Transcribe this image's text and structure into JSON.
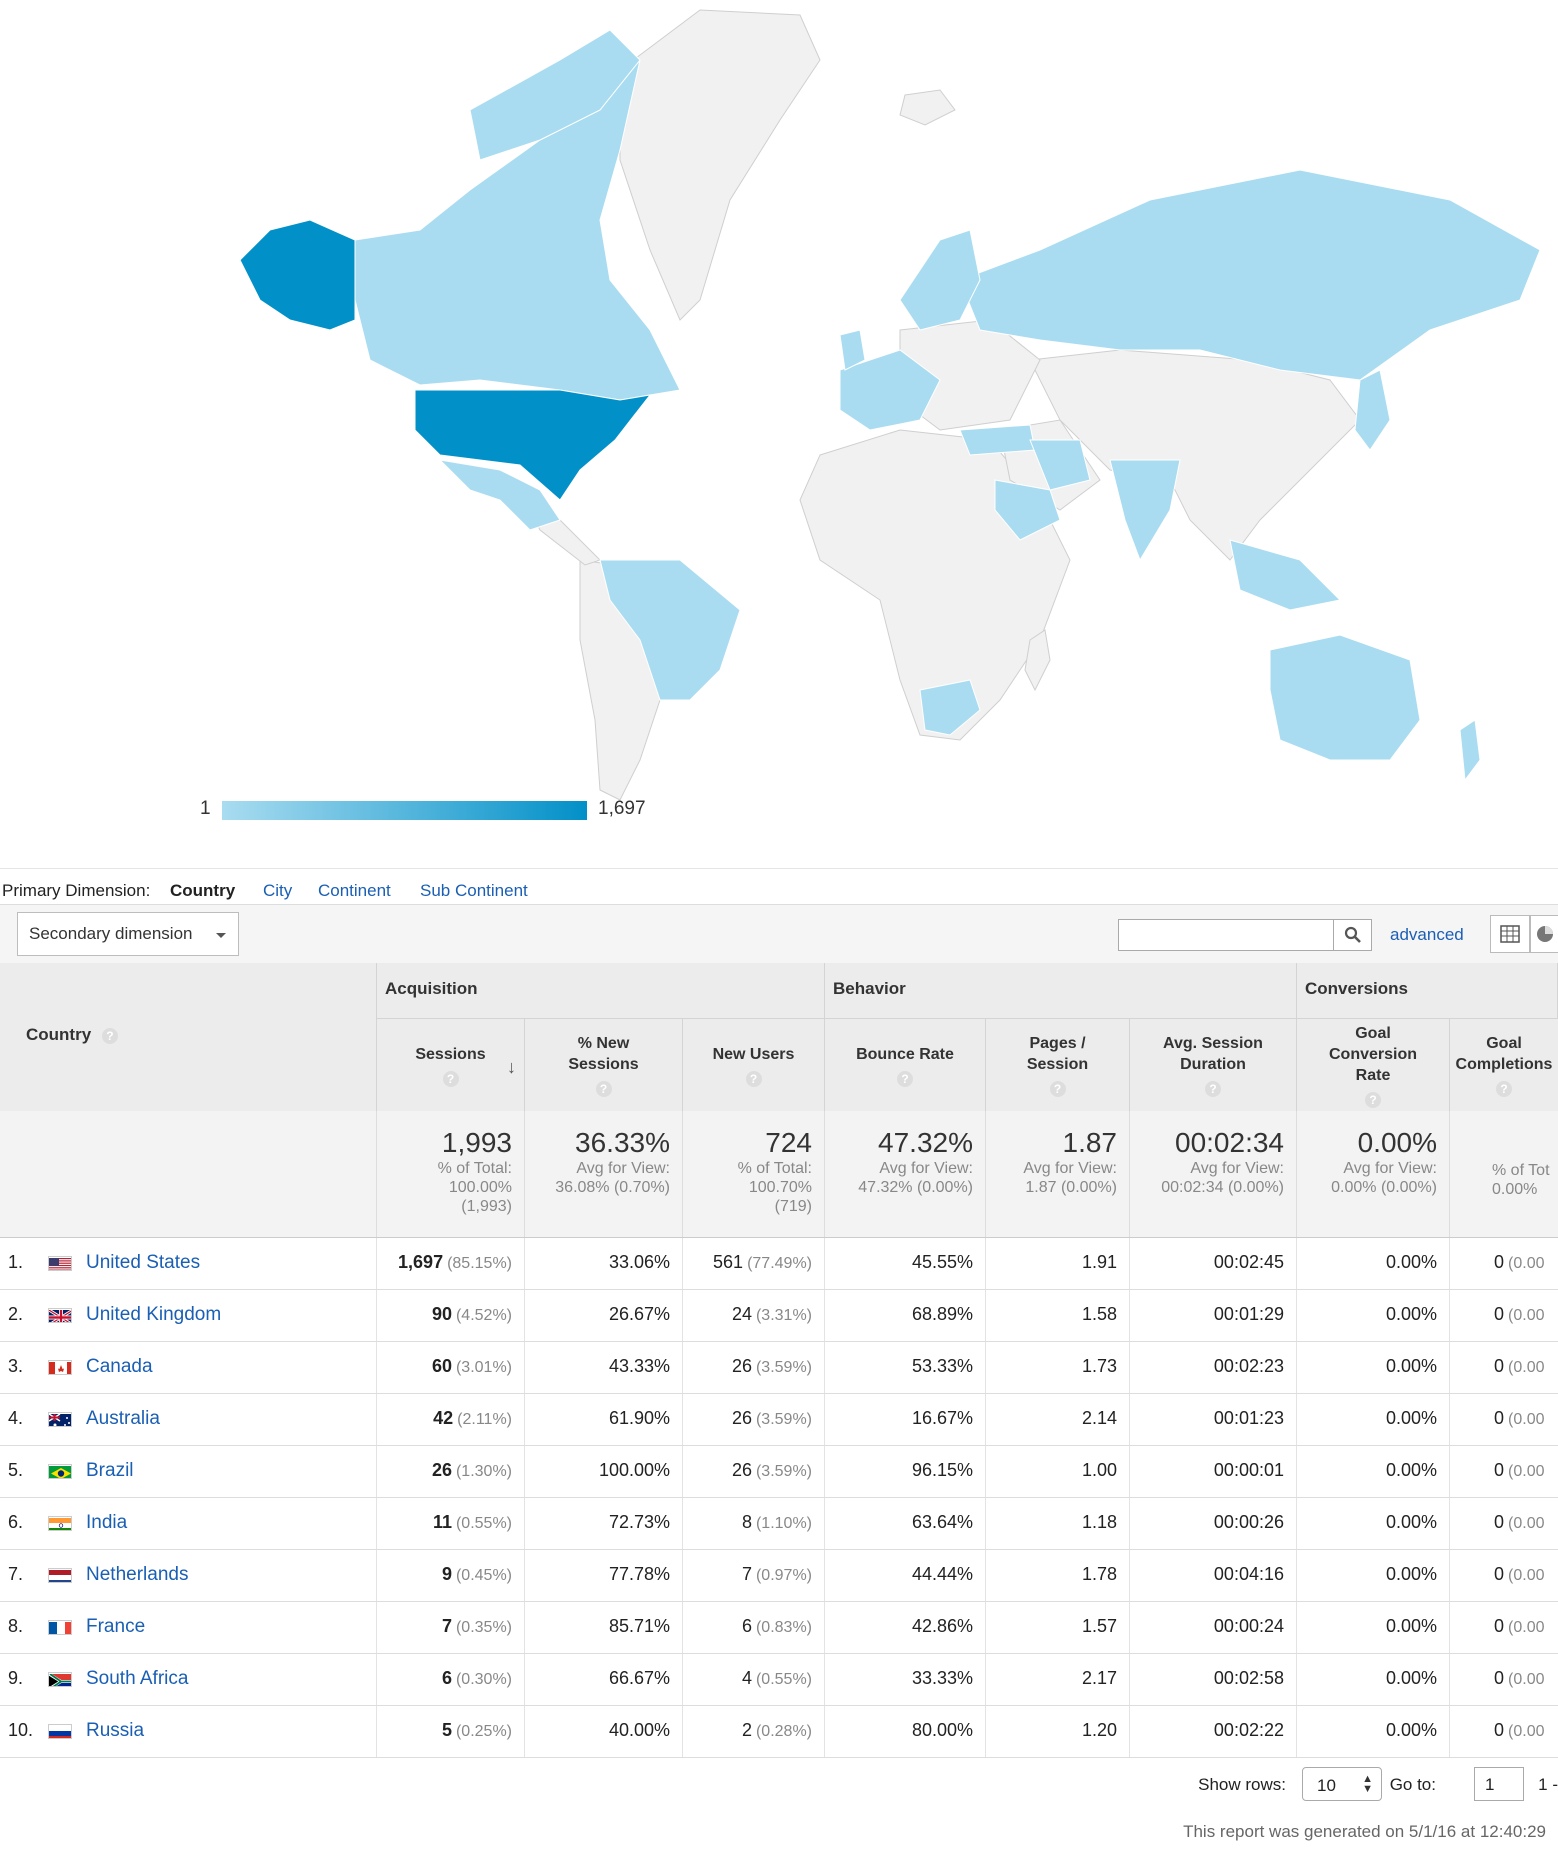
{
  "map": {
    "legend_min": "1",
    "legend_max": "1,697",
    "colors": {
      "low": "#a9dcf0",
      "high": "#0290c8",
      "none": "#f1f1f1"
    }
  },
  "dimensions": {
    "label": "Primary Dimension:",
    "items": [
      "Country",
      "City",
      "Continent",
      "Sub Continent"
    ],
    "active": "Country"
  },
  "toolbar": {
    "secondary_dimension": "Secondary dimension",
    "search_value": "",
    "advanced": "advanced"
  },
  "table": {
    "country_header": "Country",
    "groups": [
      "Acquisition",
      "Behavior",
      "Conversions"
    ],
    "columns": [
      "Sessions",
      "% New Sessions",
      "New Users",
      "Bounce Rate",
      "Pages / Session",
      "Avg. Session Duration",
      "Goal Conversion Rate",
      "Goal Completions"
    ],
    "totals": [
      {
        "big": "1,993",
        "sub1": "% of Total:",
        "sub2": "100.00%",
        "sub3": "(1,993)"
      },
      {
        "big": "36.33%",
        "sub1": "Avg for View:",
        "sub2": "36.08% (0.70%)",
        "sub3": ""
      },
      {
        "big": "724",
        "sub1": "% of Total:",
        "sub2": "100.70%",
        "sub3": "(719)"
      },
      {
        "big": "47.32%",
        "sub1": "Avg for View:",
        "sub2": "47.32% (0.00%)",
        "sub3": ""
      },
      {
        "big": "1.87",
        "sub1": "Avg for View:",
        "sub2": "1.87 (0.00%)",
        "sub3": ""
      },
      {
        "big": "00:02:34",
        "sub1": "Avg for View:",
        "sub2": "00:02:34 (0.00%)",
        "sub3": ""
      },
      {
        "big": "0.00%",
        "sub1": "Avg for View:",
        "sub2": "0.00% (0.00%)",
        "sub3": ""
      },
      {
        "big": "",
        "sub1": "% of Tot",
        "sub2": "0.00%",
        "sub3": ""
      }
    ],
    "rows": [
      {
        "num": "1.",
        "country": "United States",
        "flag": "us",
        "sessions": "1,697",
        "sessions_pct": "(85.15%)",
        "new_sessions": "33.06%",
        "new_users": "561",
        "new_users_pct": "(77.49%)",
        "bounce": "45.55%",
        "pages": "1.91",
        "duration": "00:02:45",
        "conv_rate": "0.00%",
        "completions": "0",
        "completions_pct": "(0.00"
      },
      {
        "num": "2.",
        "country": "United Kingdom",
        "flag": "gb",
        "sessions": "90",
        "sessions_pct": "(4.52%)",
        "new_sessions": "26.67%",
        "new_users": "24",
        "new_users_pct": "(3.31%)",
        "bounce": "68.89%",
        "pages": "1.58",
        "duration": "00:01:29",
        "conv_rate": "0.00%",
        "completions": "0",
        "completions_pct": "(0.00"
      },
      {
        "num": "3.",
        "country": "Canada",
        "flag": "ca",
        "sessions": "60",
        "sessions_pct": "(3.01%)",
        "new_sessions": "43.33%",
        "new_users": "26",
        "new_users_pct": "(3.59%)",
        "bounce": "53.33%",
        "pages": "1.73",
        "duration": "00:02:23",
        "conv_rate": "0.00%",
        "completions": "0",
        "completions_pct": "(0.00"
      },
      {
        "num": "4.",
        "country": "Australia",
        "flag": "au",
        "sessions": "42",
        "sessions_pct": "(2.11%)",
        "new_sessions": "61.90%",
        "new_users": "26",
        "new_users_pct": "(3.59%)",
        "bounce": "16.67%",
        "pages": "2.14",
        "duration": "00:01:23",
        "conv_rate": "0.00%",
        "completions": "0",
        "completions_pct": "(0.00"
      },
      {
        "num": "5.",
        "country": "Brazil",
        "flag": "br",
        "sessions": "26",
        "sessions_pct": "(1.30%)",
        "new_sessions": "100.00%",
        "new_users": "26",
        "new_users_pct": "(3.59%)",
        "bounce": "96.15%",
        "pages": "1.00",
        "duration": "00:00:01",
        "conv_rate": "0.00%",
        "completions": "0",
        "completions_pct": "(0.00"
      },
      {
        "num": "6.",
        "country": "India",
        "flag": "in",
        "sessions": "11",
        "sessions_pct": "(0.55%)",
        "new_sessions": "72.73%",
        "new_users": "8",
        "new_users_pct": "(1.10%)",
        "bounce": "63.64%",
        "pages": "1.18",
        "duration": "00:00:26",
        "conv_rate": "0.00%",
        "completions": "0",
        "completions_pct": "(0.00"
      },
      {
        "num": "7.",
        "country": "Netherlands",
        "flag": "nl",
        "sessions": "9",
        "sessions_pct": "(0.45%)",
        "new_sessions": "77.78%",
        "new_users": "7",
        "new_users_pct": "(0.97%)",
        "bounce": "44.44%",
        "pages": "1.78",
        "duration": "00:04:16",
        "conv_rate": "0.00%",
        "completions": "0",
        "completions_pct": "(0.00"
      },
      {
        "num": "8.",
        "country": "France",
        "flag": "fr",
        "sessions": "7",
        "sessions_pct": "(0.35%)",
        "new_sessions": "85.71%",
        "new_users": "6",
        "new_users_pct": "(0.83%)",
        "bounce": "42.86%",
        "pages": "1.57",
        "duration": "00:00:24",
        "conv_rate": "0.00%",
        "completions": "0",
        "completions_pct": "(0.00"
      },
      {
        "num": "9.",
        "country": "South Africa",
        "flag": "za",
        "sessions": "6",
        "sessions_pct": "(0.30%)",
        "new_sessions": "66.67%",
        "new_users": "4",
        "new_users_pct": "(0.55%)",
        "bounce": "33.33%",
        "pages": "2.17",
        "duration": "00:02:58",
        "conv_rate": "0.00%",
        "completions": "0",
        "completions_pct": "(0.00"
      },
      {
        "num": "10.",
        "country": "Russia",
        "flag": "ru",
        "sessions": "5",
        "sessions_pct": "(0.25%)",
        "new_sessions": "40.00%",
        "new_users": "2",
        "new_users_pct": "(0.28%)",
        "bounce": "80.00%",
        "pages": "1.20",
        "duration": "00:02:22",
        "conv_rate": "0.00%",
        "completions": "0",
        "completions_pct": "(0.00"
      }
    ]
  },
  "pagination": {
    "show_rows_label": "Show rows:",
    "show_rows_value": "10",
    "goto_label": "Go to:",
    "goto_value": "1",
    "range": "1 -"
  },
  "generated": "This report was generated on 5/1/16 at 12:40:29"
}
